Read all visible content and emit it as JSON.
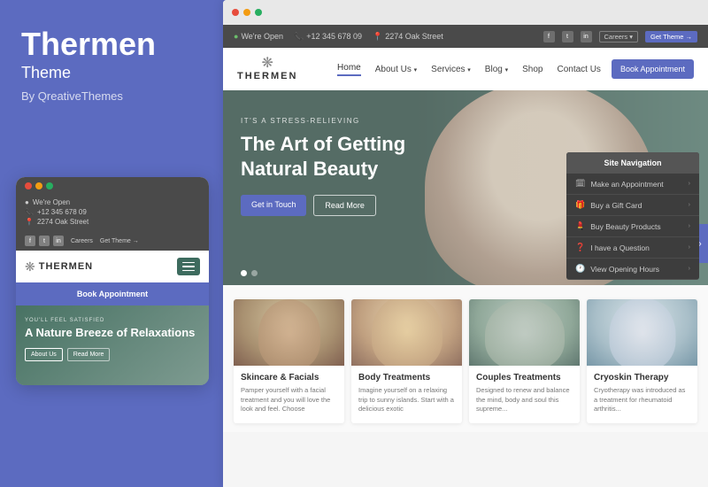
{
  "leftPanel": {
    "brandTitle": "Thermen",
    "brandSubtitle": "Theme",
    "brandBy": "By QreativeThemes"
  },
  "mobilePreview": {
    "topbar": {
      "open": "We're Open",
      "phone": "+12 345 678 09",
      "address": "2274 Oak Street",
      "careers": "Careers",
      "getTheme": "Get Theme →"
    },
    "logo": "THERMEN",
    "bookBtn": "Book Appointment",
    "hero": {
      "label": "YOU'LL FEEL SATISFIED",
      "title": "A Nature Breeze of Relaxations",
      "btn1": "About Us",
      "btn2": "Read More"
    }
  },
  "mainPreview": {
    "browser": {
      "dots": [
        "red",
        "yellow",
        "green"
      ]
    },
    "topbar": {
      "open": "We're Open",
      "phone": "+12 345 678 09",
      "address": "2274 Oak Street",
      "social": [
        "f",
        "t",
        "in"
      ],
      "careers": "Careers ▾",
      "getTheme": "Get Theme →"
    },
    "navbar": {
      "logo": "THERMEN",
      "links": [
        "Home",
        "About Us",
        "Services",
        "Blog",
        "Shop",
        "Contact Us"
      ],
      "bookBtn": "Book Appointment"
    },
    "hero": {
      "label": "IT'S A STRESS-RELIEVING",
      "title": "The Art of Getting Natural Beauty",
      "btn1": "Get in Touch",
      "btn2": "Read More",
      "dots": [
        true,
        false
      ]
    },
    "navPanel": {
      "header": "Site Navigation",
      "items": [
        {
          "icon": "📅",
          "label": "Make an Appointment"
        },
        {
          "icon": "🎁",
          "label": "Buy a Gift Card"
        },
        {
          "icon": "💄",
          "label": "Buy Beauty Products"
        },
        {
          "icon": "❓",
          "label": "I have a Question"
        },
        {
          "icon": "🕐",
          "label": "View Opening Hours"
        }
      ]
    },
    "services": {
      "cards": [
        {
          "title": "Skincare & Facials",
          "desc": "Pamper yourself with a facial treatment and you will love the look and feel. Choose"
        },
        {
          "title": "Body Treatments",
          "desc": "Imagine yourself on a relaxing trip to sunny islands. Start with a delicious exotic"
        },
        {
          "title": "Couples Treatments",
          "desc": "Designed to renew and balance the mind, body and soul this supreme..."
        },
        {
          "title": "Cryoskin Therapy",
          "desc": "Cryotherapy was introduced as a treatment for rheumatoid arthritis..."
        }
      ]
    }
  }
}
